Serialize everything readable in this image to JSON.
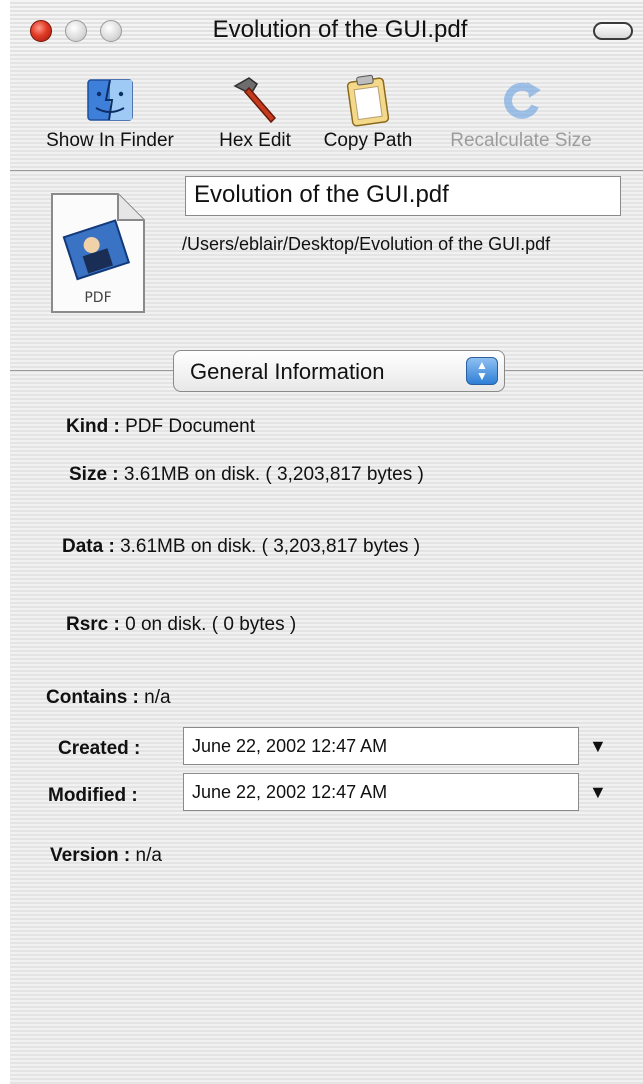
{
  "window": {
    "title": "Evolution of the GUI.pdf"
  },
  "toolbar": {
    "items": [
      {
        "label": "Show In Finder",
        "icon": "finder-icon",
        "enabled": true
      },
      {
        "label": "Hex Edit",
        "icon": "hammer-icon",
        "enabled": true
      },
      {
        "label": "Copy Path",
        "icon": "clipboard-icon",
        "enabled": true
      },
      {
        "label": "Recalculate Size",
        "icon": "refresh-icon",
        "enabled": false
      }
    ]
  },
  "file": {
    "icon_badge": "PDF",
    "name": "Evolution of the GUI.pdf",
    "path": "/Users/eblair/Desktop/Evolution of the GUI.pdf"
  },
  "section_popup": {
    "selected": "General Information"
  },
  "info": {
    "kind_label": "Kind :",
    "kind_value": "PDF Document",
    "size_label": "Size :",
    "size_value": "3.61MB on disk. ( 3,203,817 bytes )",
    "data_label": "Data :",
    "data_value": "3.61MB on disk. ( 3,203,817 bytes )",
    "rsrc_label": "Rsrc :",
    "rsrc_value": "0 on disk. ( 0 bytes )",
    "contains_label": "Contains :",
    "contains_value": "n/a",
    "created_label": "Created :",
    "created_value": "June 22, 2002 12:47 AM",
    "modified_label": "Modified :",
    "modified_value": "June 22, 2002 12:47 AM",
    "version_label": "Version :",
    "version_value": "n/a"
  },
  "colors": {
    "close_button": "#e03a26",
    "popup_arrow_blue": "#2f7fd6",
    "disabled_text": "#9c9c9c"
  }
}
